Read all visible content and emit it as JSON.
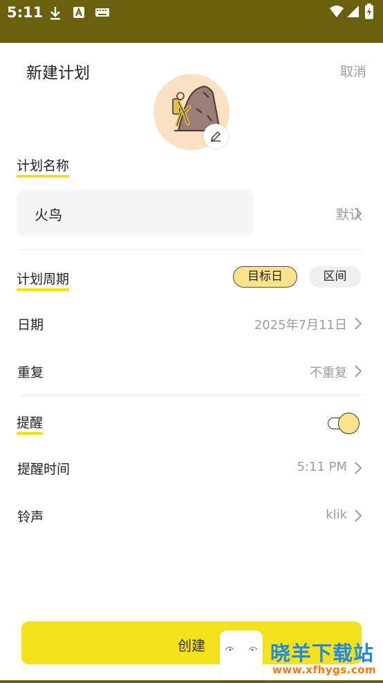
{
  "status_bar": {
    "time": "5:11",
    "icons": [
      "download-icon",
      "a-badge-icon",
      "keyboard-icon",
      "wifi-icon",
      "signal-icon",
      "battery-charging-icon"
    ]
  },
  "sheet": {
    "title": "新建计划",
    "cancel_label": "取消"
  },
  "avatar": {
    "icon": "climber-on-rock-icon",
    "edit_icon": "pencil-icon",
    "bg_color": "#fbe1c3"
  },
  "plan_name": {
    "section_label": "计划名称",
    "value": "火鸟",
    "default_label": "默认"
  },
  "plan_period": {
    "section_label": "计划周期",
    "options": [
      {
        "label": "目标日",
        "selected": true
      },
      {
        "label": "区间",
        "selected": false
      }
    ],
    "date": {
      "label": "日期",
      "value": "2025年7月11日"
    },
    "repeat": {
      "label": "重复",
      "value": "不重复"
    }
  },
  "reminder": {
    "section_label": "提醒",
    "enabled": true,
    "time": {
      "label": "提醒时间",
      "value": "5:11 PM"
    },
    "ringtone": {
      "label": "铃声",
      "value": "klik"
    }
  },
  "create_button": {
    "label": "创建",
    "color": "#f5e21a"
  },
  "watermark": {
    "title": "晓羊下载站",
    "url": "www.xfhygs.com"
  },
  "colors": {
    "accent_yellow": "#f2e11c",
    "status_bar": "#6b5e0f",
    "muted_text": "#9c9c9c"
  }
}
